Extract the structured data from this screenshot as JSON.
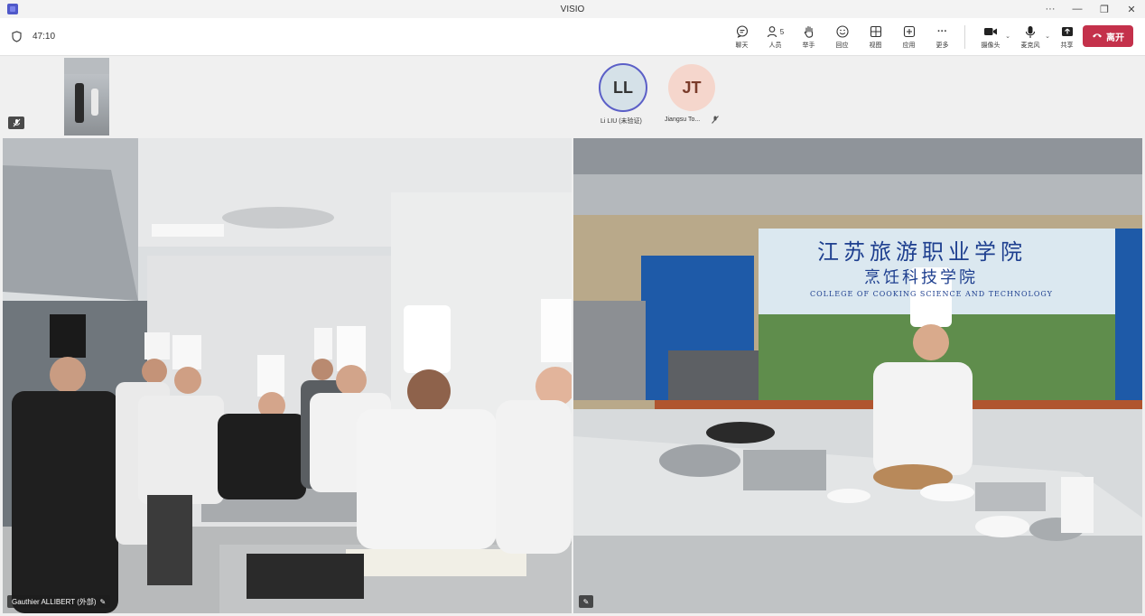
{
  "window": {
    "title": "VISIO",
    "more": "···",
    "minimize": "—",
    "restore": "❐",
    "close": "✕"
  },
  "toolbar": {
    "timer": "47:10",
    "tools": [
      {
        "name": "chat",
        "icon": "chat-icon",
        "label": "聊天",
        "glyph": "💬"
      },
      {
        "name": "people",
        "icon": "people-icon",
        "label": "人员",
        "glyph": "👤",
        "count": "5"
      },
      {
        "name": "raise-hand",
        "icon": "hand-icon",
        "label": "举手",
        "glyph": "✋"
      },
      {
        "name": "react",
        "icon": "smile-icon",
        "label": "回应",
        "glyph": "☺"
      },
      {
        "name": "view",
        "icon": "grid-icon",
        "label": "视图",
        "glyph": "⊞"
      },
      {
        "name": "apps",
        "icon": "plus-icon",
        "label": "应用",
        "glyph": "⊕"
      },
      {
        "name": "more",
        "icon": "more-icon",
        "label": "更多",
        "glyph": "···"
      }
    ],
    "camera": {
      "icon": "camera-icon",
      "label": "摄像头",
      "glyph": "■"
    },
    "mic": {
      "icon": "mic-icon",
      "label": "麦克风",
      "glyph": "🎙"
    },
    "share": {
      "icon": "share-icon",
      "label": "共享",
      "glyph": "⬆"
    },
    "leave": {
      "icon": "phone-hangup-icon",
      "label": "离开",
      "glyph": "☎"
    }
  },
  "participants": [
    {
      "initials": "LL",
      "name": "Li LIU (未验证)"
    },
    {
      "initials": "JT",
      "name": "Jiangsu To..."
    }
  ],
  "videos": {
    "left": {
      "name": "Gauthier ALLIBERT (外部)"
    },
    "right": {
      "banner_title": "江苏旅游职业学院",
      "banner_subtitle": "烹饪科技学院",
      "banner_english": "COLLEGE OF COOKING SCIENCE AND TECHNOLOGY"
    }
  },
  "colors": {
    "accent": "#5b5fc7",
    "leave": "#c4314b",
    "avatar_jt": "#f5d6cc",
    "avatar_ll": "#d5e1e8"
  }
}
